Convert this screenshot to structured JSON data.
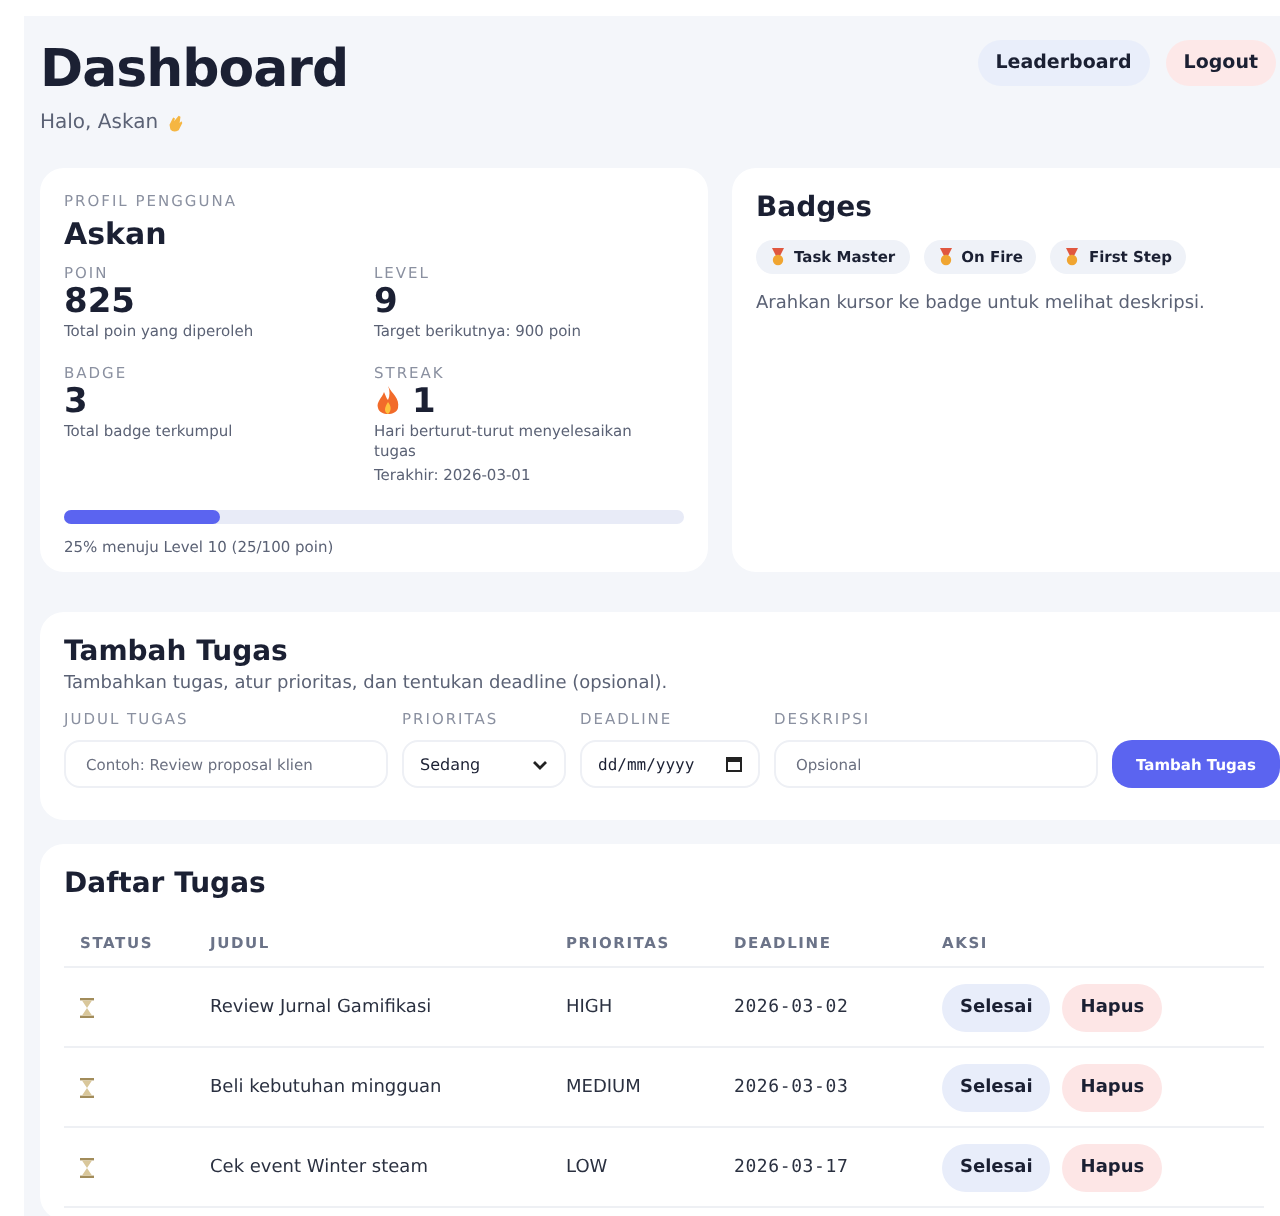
{
  "header": {
    "title": "Dashboard",
    "greeting": "Halo, Askan",
    "buttons": [
      {
        "label": "Leaderboard",
        "kind": "neutral"
      },
      {
        "label": "Logout",
        "kind": "danger"
      }
    ]
  },
  "profile": {
    "section_label": "PROFIL PENGGUNA",
    "name": "Askan",
    "stats": [
      {
        "label": "POIN",
        "value": "825",
        "note": "Total poin yang diperoleh",
        "kind": "plain"
      },
      {
        "label": "LEVEL",
        "value": "9",
        "note": "Target berikutnya: 900 poin",
        "kind": "plain"
      },
      {
        "label": "BADGE",
        "value": "3",
        "note": "Total badge terkumpul",
        "kind": "plain"
      },
      {
        "label": "STREAK",
        "value": "1",
        "note": "Hari berturut-turut menyelesaikan tugas",
        "extra": "Terakhir: 2026-03-01",
        "kind": "streak"
      }
    ],
    "progress": {
      "level": 0.25,
      "caption": "25% menuju Level 10 (25/100 poin)"
    }
  },
  "badges": {
    "title": "Badges",
    "items": [
      "Task Master",
      "On Fire",
      "First Step"
    ],
    "hint": "Arahkan kursor ke badge untuk melihat deskripsi."
  },
  "add_task": {
    "title": "Tambah Tugas",
    "subtitle": "Tambahkan tugas, atur prioritas, dan tentukan deadline (opsional).",
    "fields": [
      {
        "label": "JUDUL TUGAS",
        "kind": "text",
        "placeholder": "Contoh: Review proposal klien"
      },
      {
        "label": "PRIORITAS",
        "kind": "select",
        "value": "Sedang"
      },
      {
        "label": "DEADLINE",
        "kind": "date",
        "placeholder": "dd/mm/yyyy"
      },
      {
        "label": "DESKRIPSI",
        "kind": "text",
        "placeholder": "Opsional"
      }
    ],
    "submit": "Tambah Tugas"
  },
  "task_list": {
    "title": "Daftar Tugas",
    "columns": [
      "STATUS",
      "JUDUL",
      "PRIORITAS",
      "DEADLINE",
      "AKSI"
    ],
    "rows": [
      {
        "done": false,
        "title": "Review Jurnal Gamifikasi",
        "priority": "HIGH",
        "deadline": "2026-03-02",
        "actions": [
          "Selesai",
          "Hapus"
        ]
      },
      {
        "done": false,
        "title": "Beli kebutuhan mingguan",
        "priority": "MEDIUM",
        "deadline": "2026-03-03",
        "actions": [
          "Selesai",
          "Hapus"
        ]
      },
      {
        "done": false,
        "title": "Cek event Winter steam",
        "priority": "LOW",
        "deadline": "2026-03-17",
        "actions": [
          "Selesai",
          "Hapus"
        ]
      }
    ]
  }
}
